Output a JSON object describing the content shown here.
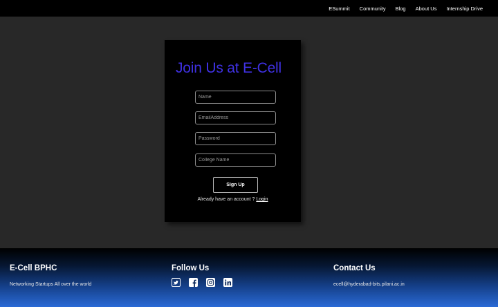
{
  "nav": {
    "items": [
      "ESummit",
      "Community",
      "Blog",
      "About Us",
      "Internship Drive"
    ]
  },
  "form": {
    "title": "Join Us at E-Cell",
    "name_placeholder": "Name",
    "email_placeholder": "EmailAddress",
    "password_placeholder": "Password",
    "college_placeholder": "College Name",
    "signup_label": "Sign Up",
    "account_prompt": "Already have an account ? ",
    "login_label": "Login"
  },
  "footer": {
    "brand_heading": "E-Cell BPHC",
    "brand_tagline": "Networking Startups All over the world",
    "follow_heading": "Follow Us",
    "social_icons": [
      "twitter-icon",
      "facebook-icon",
      "instagram-icon",
      "linkedin-icon"
    ],
    "contact_heading": "Contact Us",
    "contact_email": "ecell@hyderabad-bits.pilani.ac.in"
  },
  "colors": {
    "title": "#3f31e3",
    "page_bg": "#282828",
    "footer_gradient_end": "#2a6ad6"
  }
}
